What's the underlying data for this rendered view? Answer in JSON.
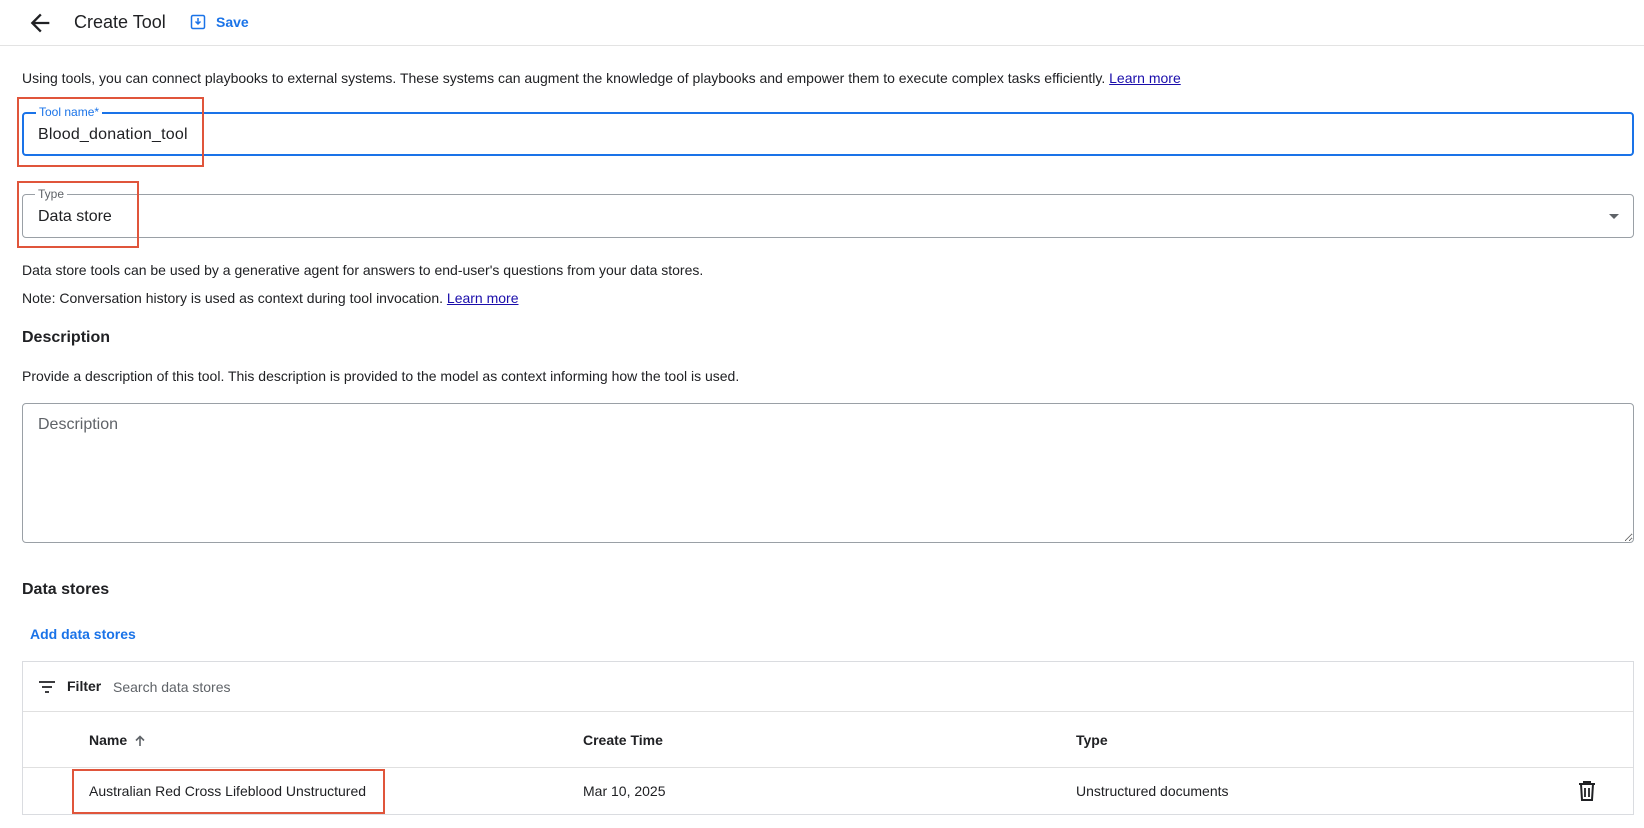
{
  "toolbar": {
    "title": "Create Tool",
    "save_label": "Save"
  },
  "intro": {
    "text": "Using tools, you can connect playbooks to external systems. These systems can augment the knowledge of playbooks and empower them to execute complex tasks efficiently.",
    "link": "Learn more"
  },
  "tool_name": {
    "label": "Tool name*",
    "value": "Blood_donation_tool"
  },
  "type": {
    "label": "Type",
    "value": "Data store"
  },
  "type_help": "Data store tools can be used by a generative agent for answers to end-user's questions from your data stores.",
  "note": {
    "text": "Note: Conversation history is used as context during tool invocation.",
    "link": "Learn more"
  },
  "description": {
    "title": "Description",
    "help": "Provide a description of this tool. This description is provided to the model as context informing how the tool is used.",
    "placeholder": "Description"
  },
  "data_stores": {
    "title": "Data stores",
    "add_label": "Add data stores",
    "filter_label": "Filter",
    "search_placeholder": "Search data stores",
    "columns": {
      "name": "Name",
      "create_time": "Create Time",
      "type": "Type"
    },
    "rows": [
      {
        "name": "Australian Red Cross Lifeblood Unstructured",
        "create_time": "Mar 10, 2025",
        "type": "Unstructured documents"
      }
    ]
  },
  "colors": {
    "accent": "#1a73e8",
    "highlight": "#e0553b",
    "link": "#1a0dab"
  },
  "icons": [
    "arrow-back-icon",
    "save-icon",
    "dropdown-arrow-icon",
    "filter-icon",
    "sort-arrow-up-icon",
    "delete-icon"
  ]
}
